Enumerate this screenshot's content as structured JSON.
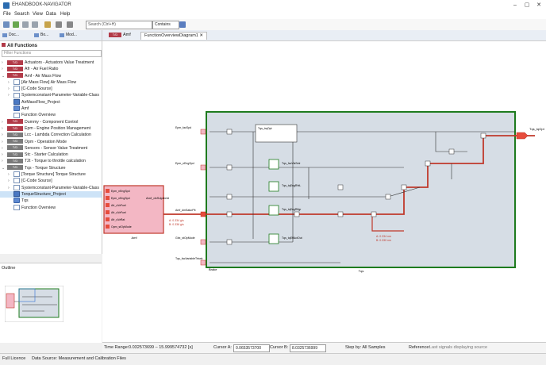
{
  "window": {
    "title": "EHANDBOOK-NAVIGATOR"
  },
  "menu": [
    "File",
    "Search",
    "View",
    "Data",
    "Help"
  ],
  "toolbar": {
    "search_placeholder": "Search (Ctrl+H)",
    "contains": "Contains"
  },
  "left_tabs": [
    "Doc...",
    "Bo...",
    "Mod..."
  ],
  "panel": {
    "title": "All Functions",
    "filter_placeholder": "Filter Functions"
  },
  "tree": [
    {
      "indent": 0,
      "arrow": "›",
      "badge": "red",
      "code": "T/D",
      "label": "Actuators - Actuators Value Treatment"
    },
    {
      "indent": 0,
      "arrow": "›",
      "badge": "red",
      "code": "T/D",
      "label": "Afr - Air Fuel Ratio"
    },
    {
      "indent": 0,
      "arrow": "⌄",
      "badge": "red",
      "code": "T/D",
      "label": "Amf - Air Mass Flow"
    },
    {
      "indent": 1,
      "arrow": "›",
      "icon": "doc",
      "label": "[Air Mass Flow] Air Mass Flow"
    },
    {
      "indent": 1,
      "arrow": "›",
      "icon": "doc",
      "label": "[C-Code Source]"
    },
    {
      "indent": 1,
      "arrow": "›",
      "icon": "doc",
      "label": "Systemconstant-Parameter-Variable-Class"
    },
    {
      "indent": 1,
      "arrow": "",
      "icon": "blue",
      "label": "AirMassFlow_Project"
    },
    {
      "indent": 1,
      "arrow": "",
      "icon": "fn",
      "label": "Amf"
    },
    {
      "indent": 1,
      "arrow": "",
      "icon": "doc",
      "label": "Function Overview"
    },
    {
      "indent": 0,
      "arrow": "›",
      "badge": "red",
      "code": "T/D",
      "label": "Dummy - Component Control"
    },
    {
      "indent": 0,
      "arrow": "›",
      "badge": "red",
      "code": "T/D",
      "label": "Epm - Engine Position Management"
    },
    {
      "indent": 0,
      "arrow": "›",
      "badge": "gray",
      "code": "T/D",
      "label": "Lcc - Lambda Correction Calculation"
    },
    {
      "indent": 0,
      "arrow": "›",
      "badge": "gray",
      "code": "T/D",
      "label": "Opm - Operation Mode"
    },
    {
      "indent": 0,
      "arrow": "›",
      "badge": "gray",
      "code": "T/D",
      "label": "Sensors - Sensor Value Treatment"
    },
    {
      "indent": 0,
      "arrow": "›",
      "badge": "gray",
      "code": "T/D",
      "label": "Stc - Starter Calculation"
    },
    {
      "indent": 0,
      "arrow": "›",
      "badge": "gray",
      "code": "T/D",
      "label": "T2t - Torque to throttle calculation"
    },
    {
      "indent": 0,
      "arrow": "⌄",
      "badge": "gray",
      "code": "T/D",
      "label": "Tqs - Torque Structure"
    },
    {
      "indent": 1,
      "arrow": "›",
      "icon": "doc",
      "label": "[Torque Structure] Torque Structure"
    },
    {
      "indent": 1,
      "arrow": "›",
      "icon": "doc",
      "label": "[C-Code Source]"
    },
    {
      "indent": 1,
      "arrow": "›",
      "icon": "doc",
      "label": "Systemconstant-Parameter-Variable-Class"
    },
    {
      "indent": 1,
      "arrow": "",
      "icon": "blue",
      "label": "TorqueStructure_Project",
      "selected": true
    },
    {
      "indent": 1,
      "arrow": "",
      "icon": "fn",
      "label": "Tqs"
    },
    {
      "indent": 1,
      "arrow": "",
      "icon": "doc",
      "label": "Function Overview"
    }
  ],
  "outline": {
    "title": "Outline"
  },
  "main_tabs": [
    {
      "label": "Amf",
      "badge": "T/D",
      "active": false
    },
    {
      "label": "FunctionOverviewDiagram1",
      "active": true
    }
  ],
  "diagram": {
    "left_block_label": "Amf",
    "left_block_title": "Amf_dnSdprbrkt",
    "left_inputs": [
      "Epm_nEngSpd",
      "Epm_nEngSpd",
      "Afr_rAirFuel",
      "Afr_rAirFuel",
      "Afr_rAirRat",
      "Opm_stOpMode"
    ],
    "left_output_values": "A: 0.334 g/s\nB: 0.330 g/s",
    "main_block_label": "Tqs",
    "main_block_sub": "Brake",
    "inputs": [
      "Epm_facSpd",
      "Epm_nEngSpd",
      "Amf_dmSaturPit",
      "Gbx_stOpMode",
      "Tqs_facVariableTrbwk"
    ],
    "outputs": [
      "Tqs_tqOpt"
    ],
    "blocks": [
      "Tqs_trqOpt",
      "Tqs_facVlsSelr",
      "Tqs_tqEngRhtL",
      "Tqs_tqEngRflgr",
      "Tqs_tqEffActOut"
    ],
    "value_labels": [
      "A: 0.334 g/s",
      "B: 0.336 g/s",
      "A: 0.334 nm",
      "B: 0.330 nm"
    ]
  },
  "status": {
    "time_range_label": "Time Range:",
    "time_range": "0.032573699 – 15.999574732 [s]",
    "cursor_a_label": "Cursor A:",
    "cursor_a": "0.0653573700",
    "cursor_b_label": "Cursor B:",
    "cursor_b": "8.0325736999",
    "step_label": "Step by: All Samples",
    "reference_label": "Reference:",
    "reference_value": "Last signals displaying source"
  },
  "bottom": {
    "licence": "Full Licence",
    "datasource": "Data Source:  Measurement and Calibration Files"
  },
  "colors": {
    "accent_red": "#c0392b",
    "diagram_green": "#1e7b1e",
    "diagram_bg": "#d6dde5"
  }
}
